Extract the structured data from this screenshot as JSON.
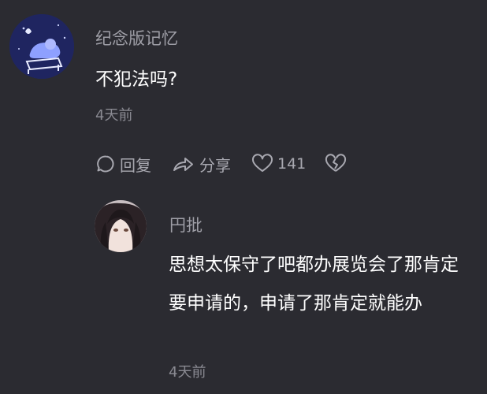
{
  "comments": [
    {
      "username": "纪念版记忆",
      "text": "不犯法吗?",
      "time": "4天前",
      "actions": {
        "reply_label": "回复",
        "share_label": "分享",
        "like_count": "141"
      }
    }
  ],
  "replies": [
    {
      "username": "円批",
      "text": "思想太保守了吧都办展览会了那肯定要申请的，申请了那肯定就能办",
      "time": "4天前"
    }
  ],
  "icons": {
    "reply": "comment-bubble-icon",
    "share": "share-arrow-icon",
    "like": "heart-outline-icon",
    "dislike": "broken-heart-icon"
  },
  "colors": {
    "background": "#2b2b31",
    "username": "#9e9ea6",
    "text": "#ffffff",
    "meta": "#8a8a92"
  }
}
